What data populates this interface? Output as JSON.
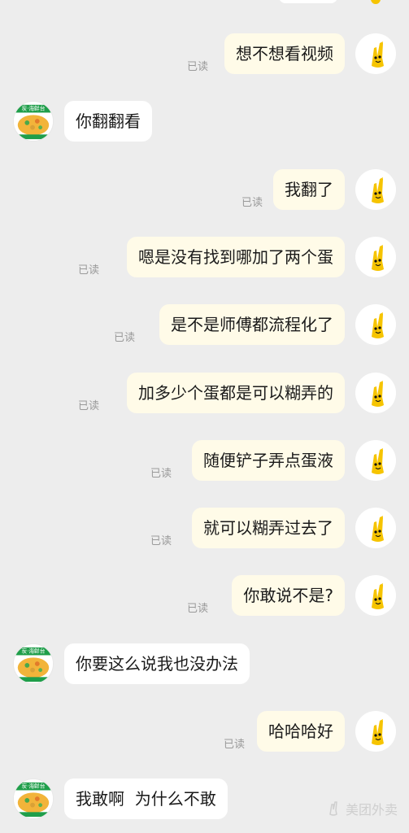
{
  "read_label": "已读",
  "watermark_text": "美团外卖",
  "colors": {
    "background": "#ededed",
    "self_bubble": "#fffbe8",
    "other_bubble": "#ffffff",
    "self_avatar_accent": "#f6c400"
  },
  "messages": [
    {
      "from": "self",
      "text": "想不想看视频",
      "read": true
    },
    {
      "from": "other",
      "text": "你翻翻看"
    },
    {
      "from": "self",
      "text": "我翻了",
      "read": true
    },
    {
      "from": "self",
      "text": "嗯是没有找到哪加了两个蛋",
      "read": true
    },
    {
      "from": "self",
      "text": "是不是师傅都流程化了",
      "read": true
    },
    {
      "from": "self",
      "text": "加多少个蛋都是可以糊弄的",
      "read": true
    },
    {
      "from": "self",
      "text": "随便铲子弄点蛋液",
      "read": true
    },
    {
      "from": "self",
      "text": "就可以糊弄过去了",
      "read": true
    },
    {
      "from": "self",
      "text": "你敢说不是?",
      "read": true
    },
    {
      "from": "other",
      "text": "你要这么说我也没办法"
    },
    {
      "from": "self",
      "text": "哈哈哈好",
      "read": true
    },
    {
      "from": "other",
      "text": "我敢啊  为什么不敢"
    }
  ]
}
